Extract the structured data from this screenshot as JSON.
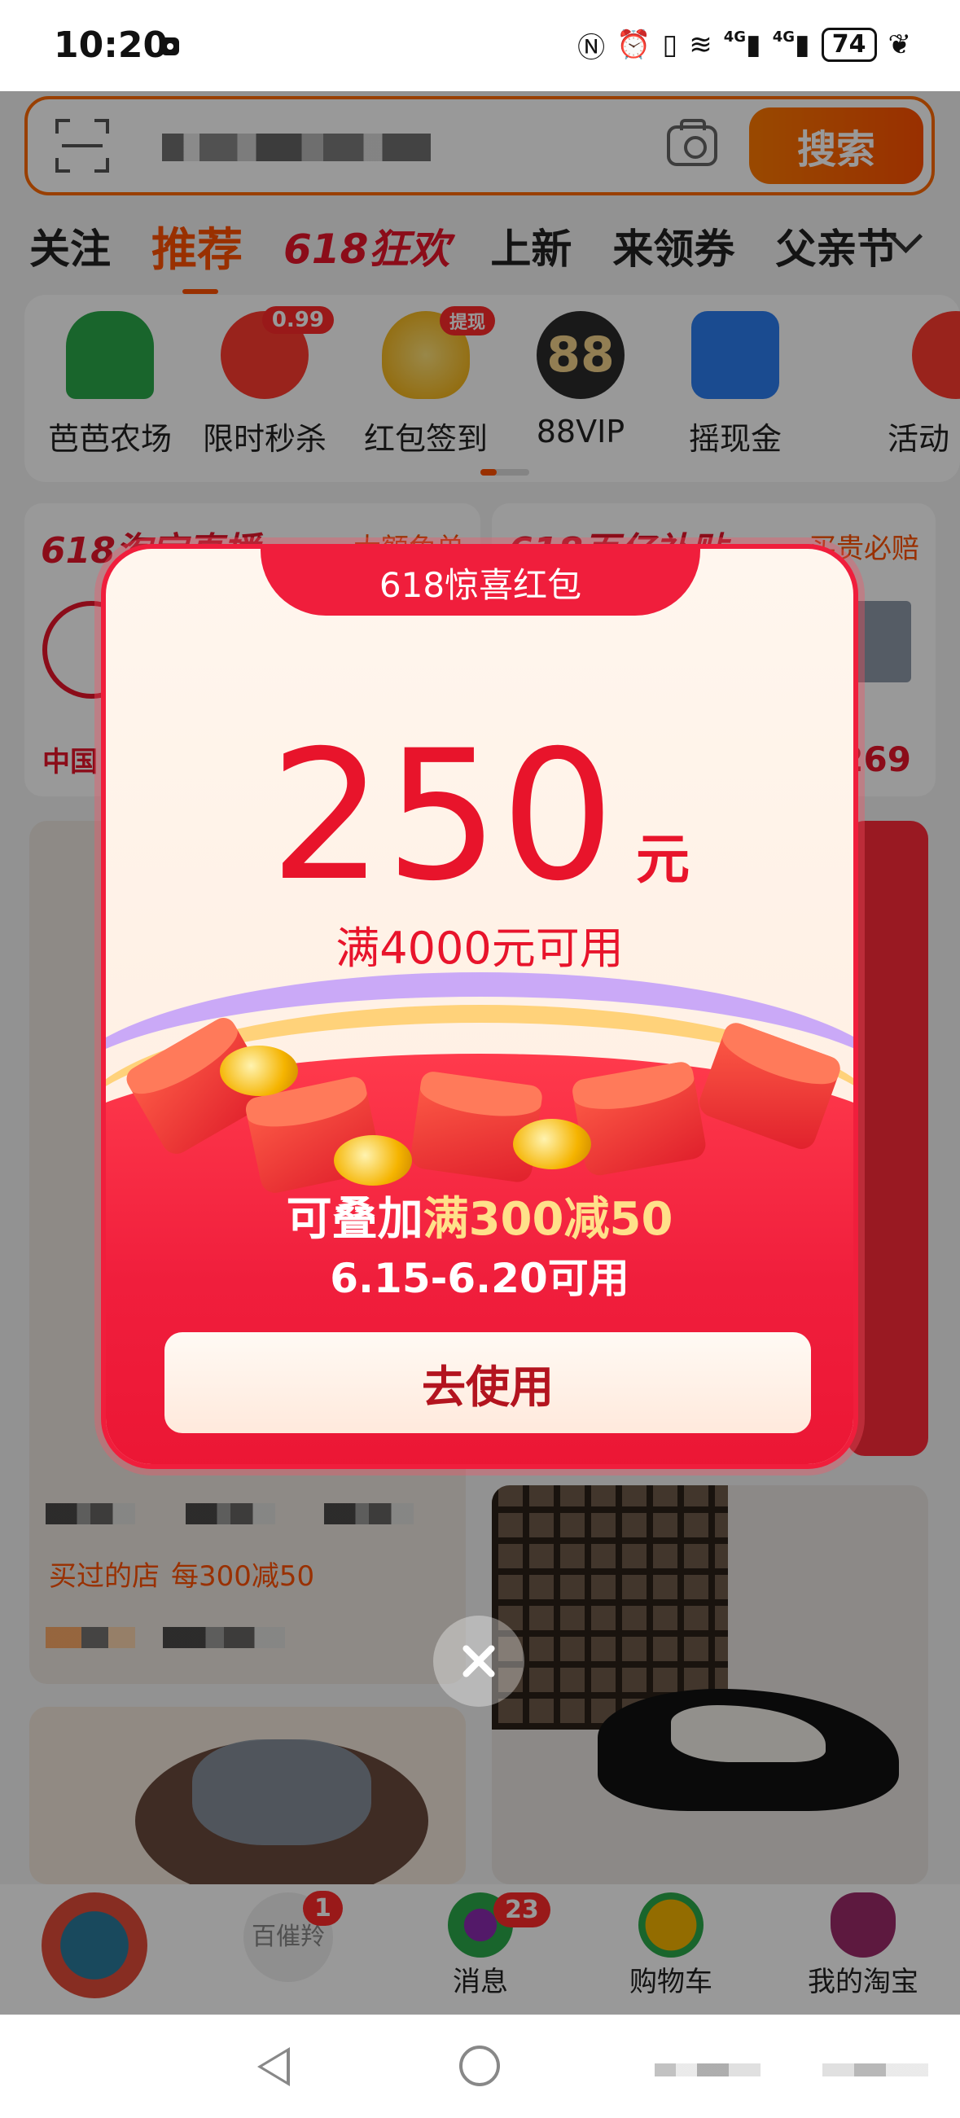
{
  "status_bar": {
    "time": "10:20",
    "network_1": "4G",
    "network_2": "4G",
    "battery": "74"
  },
  "search": {
    "placeholder": "",
    "button": "搜索"
  },
  "tabs": [
    "关注",
    "推荐",
    "618狂欢",
    "上新",
    "来领券",
    "父亲节"
  ],
  "apps": [
    {
      "label": "芭芭农场",
      "icon": "tree-house-icon",
      "badge": ""
    },
    {
      "label": "限时秒杀",
      "icon": "alarm-lightning-icon",
      "badge": "0.99"
    },
    {
      "label": "红包签到",
      "icon": "gold-ingot-icon",
      "badge": "提现"
    },
    {
      "label": "88VIP",
      "icon": "88-badge-icon",
      "badge": ""
    },
    {
      "label": "摇现金",
      "icon": "cash-bag-icon",
      "badge": ""
    },
    {
      "label": "活动",
      "icon": "partial-icon",
      "badge": ""
    }
  ],
  "promos": [
    {
      "title": "618淘宝直播",
      "subtitle": "大额免单",
      "shop": "中国"
    },
    {
      "title": "618百亿补贴",
      "subtitle": "买贵必赔",
      "price": "269"
    }
  ],
  "feed": {
    "shop_label": "买过的店",
    "shop_deal": "每300减50"
  },
  "popup": {
    "title": "618惊喜红包",
    "amount": "250",
    "unit": "元",
    "condition": "满4000元可用",
    "stack_prefix": "可叠加",
    "stack_highlight": "满300减50",
    "date_range": "6.15-6.20可用",
    "use_button": "去使用"
  },
  "bottom_nav": [
    {
      "label": "",
      "icon": "home-emblem-icon"
    },
    {
      "label": "百催羚",
      "badge": "1",
      "icon": "brand-icon"
    },
    {
      "label": "消息",
      "badge": "23",
      "icon": "message-icon"
    },
    {
      "label": "购物车",
      "icon": "cart-icon"
    },
    {
      "label": "我的淘宝",
      "icon": "profile-icon"
    }
  ],
  "colors": {
    "accent": "#ff5000",
    "red": "#e8142b",
    "gold": "#ffe08a"
  }
}
